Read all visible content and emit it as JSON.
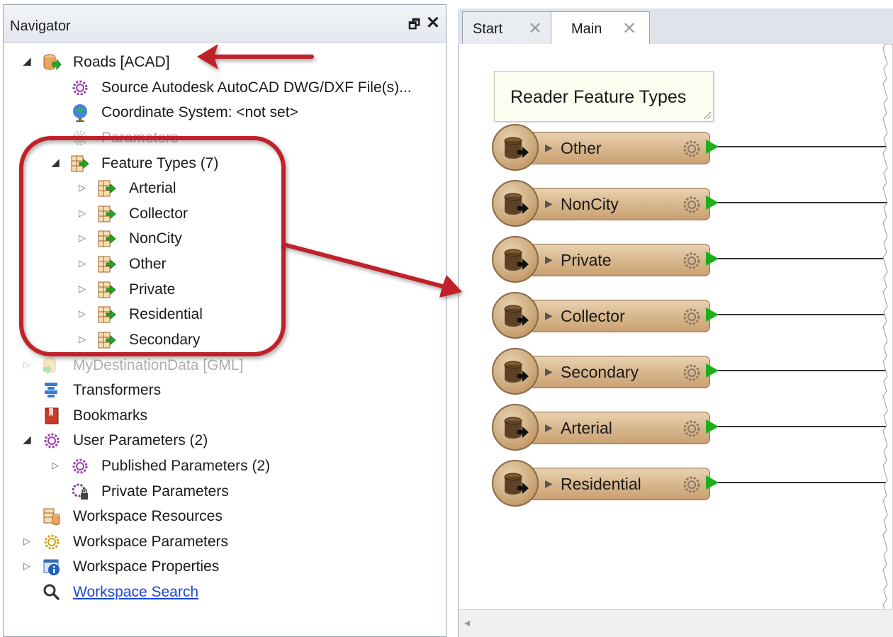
{
  "navigator": {
    "title": "Navigator",
    "float_glyph": "🗗",
    "close_glyph": "✕",
    "items": [
      {
        "label": "Roads [ACAD]",
        "icon": "reader-database-icon"
      },
      {
        "label": "Source Autodesk AutoCAD DWG/DXF File(s)...",
        "icon": "gear-purple-icon"
      },
      {
        "label": "Coordinate System: <not set>",
        "icon": "globe-icon"
      },
      {
        "label": "Parameters",
        "icon": "gear-green-icon"
      },
      {
        "label": "Feature Types (7)",
        "icon": "feature-types-icon"
      },
      {
        "label": "Arterial",
        "icon": "feature-type-icon"
      },
      {
        "label": "Collector",
        "icon": "feature-type-icon"
      },
      {
        "label": "NonCity",
        "icon": "feature-type-icon"
      },
      {
        "label": "Other",
        "icon": "feature-type-icon"
      },
      {
        "label": "Private",
        "icon": "feature-type-icon"
      },
      {
        "label": "Residential",
        "icon": "feature-type-icon"
      },
      {
        "label": "Secondary",
        "icon": "feature-type-icon"
      },
      {
        "label": "MyDestinationData [GML]",
        "icon": "writer-database-icon"
      },
      {
        "label": "Transformers",
        "icon": "transformers-icon"
      },
      {
        "label": "Bookmarks",
        "icon": "bookmark-icon"
      },
      {
        "label": "User Parameters (2)",
        "icon": "gear-purple-icon"
      },
      {
        "label": "Published Parameters (2)",
        "icon": "gear-purple-icon"
      },
      {
        "label": "Private Parameters",
        "icon": "private-gear-icon"
      },
      {
        "label": "Workspace Resources",
        "icon": "resources-icon"
      },
      {
        "label": "Workspace Parameters",
        "icon": "gear-yellow-icon"
      },
      {
        "label": "Workspace Properties",
        "icon": "info-icon"
      },
      {
        "label": "Workspace Search",
        "icon": "search-icon"
      }
    ]
  },
  "tabs": [
    {
      "label": "Start",
      "close": "✕"
    },
    {
      "label": "Main",
      "close": "✕"
    }
  ],
  "canvas": {
    "annotation": "Reader Feature Types",
    "feature_types": [
      {
        "name": "Other"
      },
      {
        "name": "NonCity"
      },
      {
        "name": "Private"
      },
      {
        "name": "Collector"
      },
      {
        "name": "Secondary"
      },
      {
        "name": "Arterial"
      },
      {
        "name": "Residential"
      }
    ],
    "scroll_left_glyph": "◂"
  },
  "colors": {
    "callout_red": "#c0212a",
    "port_green": "#1bb01b",
    "feature_tan": "#d7b58b"
  }
}
